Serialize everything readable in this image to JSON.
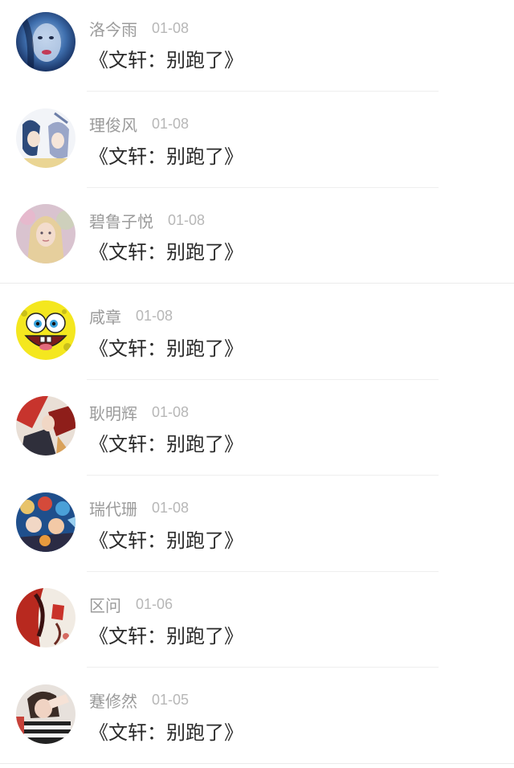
{
  "comments": [
    {
      "name": "洛今雨",
      "date": "01-08",
      "text": "《文轩：别跑了》",
      "avatar": "avatar-blue-face"
    },
    {
      "name": "理俊风",
      "date": "01-08",
      "text": "《文轩：别跑了》",
      "avatar": "avatar-anime-pair"
    },
    {
      "name": "碧鲁子悦",
      "date": "01-08",
      "text": "《文轩：别跑了》",
      "avatar": "avatar-blonde-girl"
    },
    {
      "name": "咸章",
      "date": "01-08",
      "text": "《文轩：别跑了》",
      "avatar": "avatar-spongebob"
    },
    {
      "name": "耿明辉",
      "date": "01-08",
      "text": "《文轩：别跑了》",
      "avatar": "avatar-anime-red"
    },
    {
      "name": "瑞代珊",
      "date": "01-08",
      "text": "《文轩：别跑了》",
      "avatar": "avatar-anime-crowd"
    },
    {
      "name": "区问",
      "date": "01-06",
      "text": "《文轩：别跑了》",
      "avatar": "avatar-red-ink"
    },
    {
      "name": "蹇修然",
      "date": "01-05",
      "text": "《文轩：别跑了》",
      "avatar": "avatar-striped-shirt"
    }
  ]
}
